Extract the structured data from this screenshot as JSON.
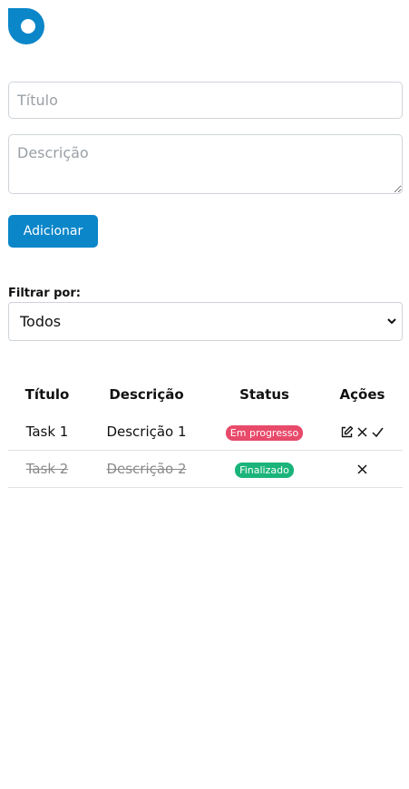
{
  "brand": {
    "logo_icon": "logo-icon",
    "color": "#0a86c9"
  },
  "form": {
    "title_placeholder": "Título",
    "description_placeholder": "Descrição",
    "add_label": "Adicionar"
  },
  "filter": {
    "label": "Filtrar por:",
    "selected": "Todos"
  },
  "table": {
    "headers": [
      "Título",
      "Descrição",
      "Status",
      "Ações"
    ],
    "rows": [
      {
        "title": "Task 1",
        "description": "Descrição 1",
        "status": "Em progresso",
        "status_color": "#e84a6a",
        "completed": false,
        "actions": [
          "edit-icon",
          "close-icon",
          "check-icon"
        ]
      },
      {
        "title": "Task 2",
        "description": "Descrição 2",
        "status": "Finalizado",
        "status_color": "#1ab47a",
        "completed": true,
        "actions": [
          "close-icon"
        ]
      }
    ]
  }
}
